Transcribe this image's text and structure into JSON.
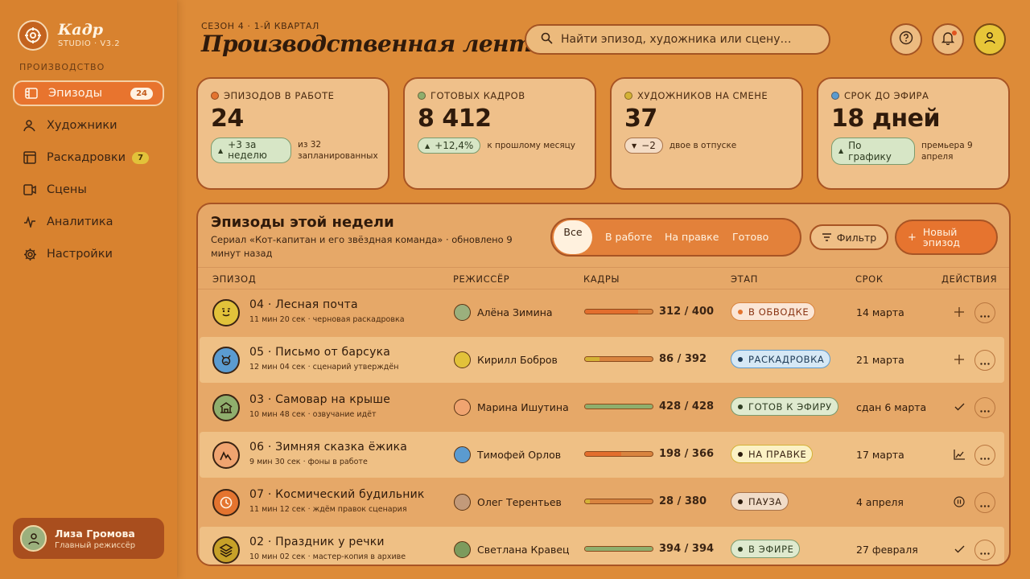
{
  "app": {
    "name": "Кадр",
    "sub": "STUDIO · V3.2"
  },
  "sidebar": {
    "section": "ПРОИЗВОДСТВО",
    "items": [
      {
        "label": "Эпизоды",
        "badge": "24",
        "icon": "film-icon"
      },
      {
        "label": "Художники",
        "badge": "",
        "icon": "person-icon"
      },
      {
        "label": "Раскадровки",
        "badge": "7",
        "icon": "storyboard-icon"
      },
      {
        "label": "Сцены",
        "badge": "",
        "icon": "camera-icon"
      },
      {
        "label": "Аналитика",
        "badge": "",
        "icon": "pulse-icon"
      },
      {
        "label": "Настройки",
        "badge": "",
        "icon": "gear-icon"
      }
    ],
    "user": {
      "name": "Лиза Громова",
      "role": "Главный режиссёр"
    }
  },
  "header": {
    "season": "СЕЗОН 4 · 1-Й КВАРТАЛ",
    "title": "Производственная лента",
    "search_placeholder": "Найти эпизод, художника или сцену…"
  },
  "stats": [
    {
      "label": "ЭПИЗОДОВ В РАБОТЕ",
      "color": "#e4742f",
      "value": "24",
      "delta": "+3 за неделю",
      "dir": "up",
      "note": "из 32 запланированных"
    },
    {
      "label": "ГОТОВЫХ КАДРОВ",
      "color": "#8fae6d",
      "value": "8 412",
      "delta": "+12,4%",
      "dir": "up",
      "note": "к прошлому месяцу"
    },
    {
      "label": "ХУДОЖНИКОВ НА СМЕНЕ",
      "color": "#d4b236",
      "value": "37",
      "delta": "−2",
      "dir": "down",
      "note": "двое в отпуске"
    },
    {
      "label": "СРОК ДО ЭФИРА",
      "color": "#5b9bd0",
      "value": "18 дней",
      "delta": "По графику",
      "dir": "up",
      "note": "премьера 9 апреля"
    }
  ],
  "panel": {
    "title": "Эпизоды этой недели",
    "subtitle": "Сериал «Кот-капитан и его звёздная команда» · обновлено 9 минут назад",
    "tabs": [
      "Все",
      "В работе",
      "На правке",
      "Готово"
    ],
    "filter": "Фильтр",
    "new": "Новый эпизод",
    "columns": [
      "ЭПИЗОД",
      "РЕЖИССЁР",
      "КАДРЫ",
      "ЭТАП",
      "СРОК",
      "ДЕЙСТВИЯ"
    ]
  },
  "episodes": [
    {
      "title": "04 · Лесная почта",
      "meta": "11 мин 20 сек · черновая раскадровка",
      "icon": "face-icon",
      "icon_bg": "#e2c23a",
      "director": "Алёна Зимина",
      "dir_color": "#9bb07d",
      "done": 312,
      "total": 400,
      "frames": "312 / 400",
      "stage": "В ОБВОДКЕ",
      "stage_bg": "#fbe6d6",
      "stage_border": "#d9843f",
      "stage_color": "#8a3413",
      "stage_dot": "#e4742f",
      "due": "14 марта",
      "action": "plus-icon",
      "bar_color": "#e36e2d"
    },
    {
      "title": "05 · Письмо от барсука",
      "meta": "12 мин 04 сек · сценарий утверждён",
      "icon": "badger-icon",
      "icon_bg": "#5b9bd0",
      "director": "Кирилл Бобров",
      "dir_color": "#e2c23a",
      "done": 86,
      "total": 392,
      "frames": "86 / 392",
      "stage": "РАСКАДРОВКА",
      "stage_bg": "#d6e8f5",
      "stage_border": "#5b9bd0",
      "stage_color": "#1d3a56",
      "stage_dot": "#1d3a56",
      "due": "21 марта",
      "action": "plus-icon",
      "bar_color": "#d4b236"
    },
    {
      "title": "03 · Самовар на крыше",
      "meta": "10 мин 48 сек · озвучание идёт",
      "icon": "house-icon",
      "icon_bg": "#8fae6d",
      "director": "Марина Ишутина",
      "dir_color": "#f0a470",
      "done": 428,
      "total": 428,
      "frames": "428 / 428",
      "stage": "ГОТОВ К ЭФИРУ",
      "stage_bg": "#dfeacf",
      "stage_border": "#7c9b6d",
      "stage_color": "#2f3d22",
      "stage_dot": "#2f3d22",
      "due": "сдан 6 марта",
      "action": "check-icon",
      "bar_color": "#8fae6d"
    },
    {
      "title": "06 · Зимняя сказка ёжика",
      "meta": "9 мин 30 сек · фоны в работе",
      "icon": "mountain-icon",
      "icon_bg": "#f0a470",
      "director": "Тимофей Орлов",
      "dir_color": "#5b9bd0",
      "done": 198,
      "total": 366,
      "frames": "198 / 366",
      "stage": "НА ПРАВКЕ",
      "stage_bg": "#fbf1c4",
      "stage_border": "#d4b236",
      "stage_color": "#3b2413",
      "stage_dot": "#2b1a0c",
      "due": "17 марта",
      "action": "chart-icon",
      "bar_color": "#e36e2d"
    },
    {
      "title": "07 · Космический будильник",
      "meta": "11 мин 12 сек · ждём правок сценария",
      "icon": "clock-icon",
      "icon_bg": "#e4742f",
      "director": "Олег Терентьев",
      "dir_color": "#c29a7a",
      "done": 28,
      "total": 380,
      "frames": "28 / 380",
      "stage": "ПАУЗА",
      "stage_bg": "#f1dcc8",
      "stage_border": "#a8734a",
      "stage_color": "#3b2413",
      "stage_dot": "#2b1a0c",
      "due": "4 апреля",
      "action": "pause-icon",
      "bar_color": "#d4b236"
    },
    {
      "title": "02 · Праздник у речки",
      "meta": "10 мин 02 сек · мастер-копия в архиве",
      "icon": "layers-icon",
      "icon_bg": "#c7a128",
      "director": "Светлана Кравец",
      "dir_color": "#7c9b5d",
      "done": 394,
      "total": 394,
      "frames": "394 / 394",
      "stage": "В ЭФИРЕ",
      "stage_bg": "#dfeacf",
      "stage_border": "#7c9b6d",
      "stage_color": "#2f3d22",
      "stage_dot": "#2f3d22",
      "due": "27 февраля",
      "action": "check-icon",
      "bar_color": "#8fae6d"
    }
  ]
}
